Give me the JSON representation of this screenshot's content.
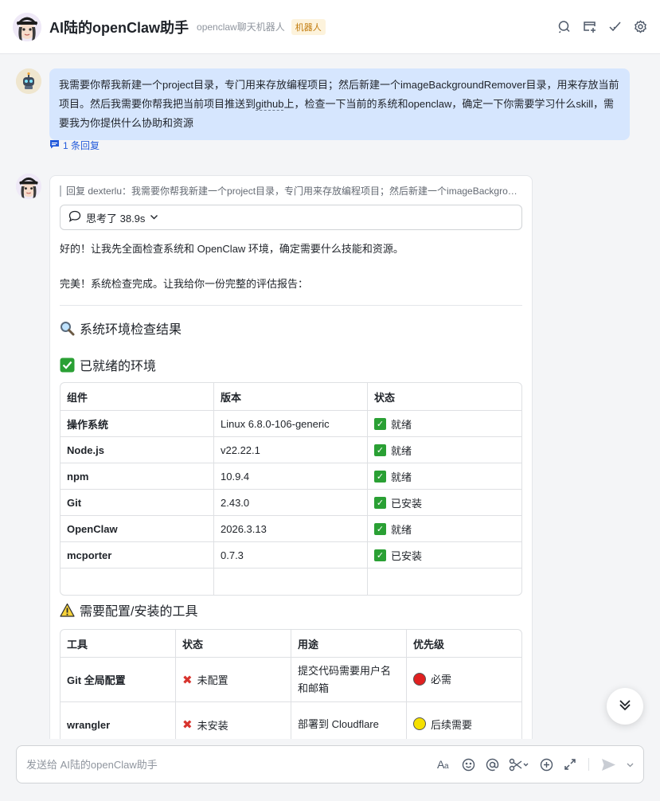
{
  "header": {
    "title": "AI陆的openClaw助手",
    "subtitle": "openclaw聊天机器人",
    "badge": "机器人"
  },
  "user_message": {
    "text_before_link": "我需要你帮我新建一个project目录，专门用来存放编程项目；然后新建一个imageBackgroundRemover目录，用来存放当前项目。然后我需要你帮我把当前项目推送到",
    "link_text": "github",
    "text_after_link": "上，检查一下当前的系统和openclaw，确定一下你需要学习什么skill，需要我为你提供什么协助和资源",
    "reply_count": "1 条回复"
  },
  "bot_reply": {
    "quote": "回复 dexterlu：我需要你帮我新建一个project目录，专门用来存放编程项目；然后新建一个imageBackgrou...",
    "thinking": "思考了 38.9s",
    "para1": "好的！让我先全面检查系统和 OpenClaw 环境，确定需要什么技能和资源。",
    "para2": "完美！系统检查完成。让我给你一份完整的评估报告：",
    "section_title": "系统环境检查结果",
    "ready_title": "已就绪的环境",
    "ready_table": {
      "headers": [
        "组件",
        "版本",
        "状态"
      ],
      "rows": [
        [
          "操作系统",
          "Linux 6.8.0-106-generic",
          "就绪"
        ],
        [
          "Node.js",
          "v22.22.1",
          "就绪"
        ],
        [
          "npm",
          "10.9.4",
          "就绪"
        ],
        [
          "Git",
          "2.43.0",
          "已安装"
        ],
        [
          "OpenClaw",
          "2026.3.13",
          "就绪"
        ],
        [
          "mcporter",
          "0.7.3",
          "已安装"
        ]
      ]
    },
    "todo_title": "需要配置/安装的工具",
    "todo_table": {
      "headers": [
        "工具",
        "状态",
        "用途",
        "优先级"
      ],
      "rows": [
        [
          "Git 全局配置",
          "未配置",
          "提交代码需要用户名和邮箱",
          "必需"
        ],
        [
          "wrangler",
          "未安装",
          "部署到 Cloudflare",
          "后续需要"
        ]
      ]
    }
  },
  "composer": {
    "placeholder": "发送给 AI陆的openClaw助手"
  },
  "icons": {
    "header": [
      "search-icon",
      "add-window-icon",
      "check-icon",
      "settings-icon"
    ],
    "composer": [
      "font-format-icon",
      "emoji-icon",
      "mention-icon",
      "scissors-icon",
      "add-icon",
      "expand-icon",
      "send-icon",
      "chevron-down-icon"
    ]
  },
  "colors": {
    "user_bubble": "#d6e6fe",
    "link": "#245bdb",
    "check_green": "#2aa034",
    "cross_red": "#d8342e",
    "priority_red": "#e02020",
    "priority_yellow": "#f5e000"
  }
}
